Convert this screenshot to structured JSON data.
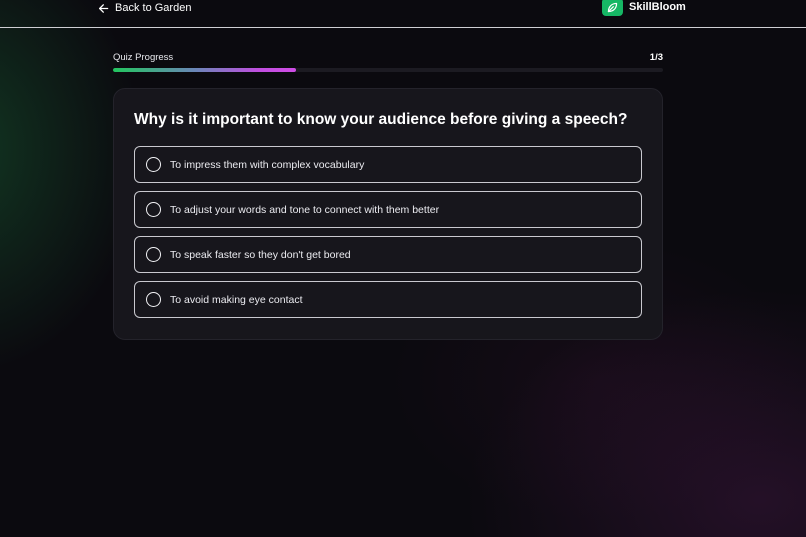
{
  "header": {
    "back_label": "Back to Garden",
    "brand_name": "SkillBloom",
    "brand_icon": "leaf-icon",
    "brand_color": "#16b765"
  },
  "progress": {
    "label": "Quiz Progress",
    "count": "1/3",
    "fraction": 0.333
  },
  "quiz": {
    "question": "Why is it important to know your audience before giving a speech?",
    "options": [
      {
        "label": "To impress them with complex vocabulary"
      },
      {
        "label": "To adjust your words and tone to connect with them better"
      },
      {
        "label": "To speak faster so they don't get bored"
      },
      {
        "label": "To avoid making eye contact"
      }
    ]
  }
}
